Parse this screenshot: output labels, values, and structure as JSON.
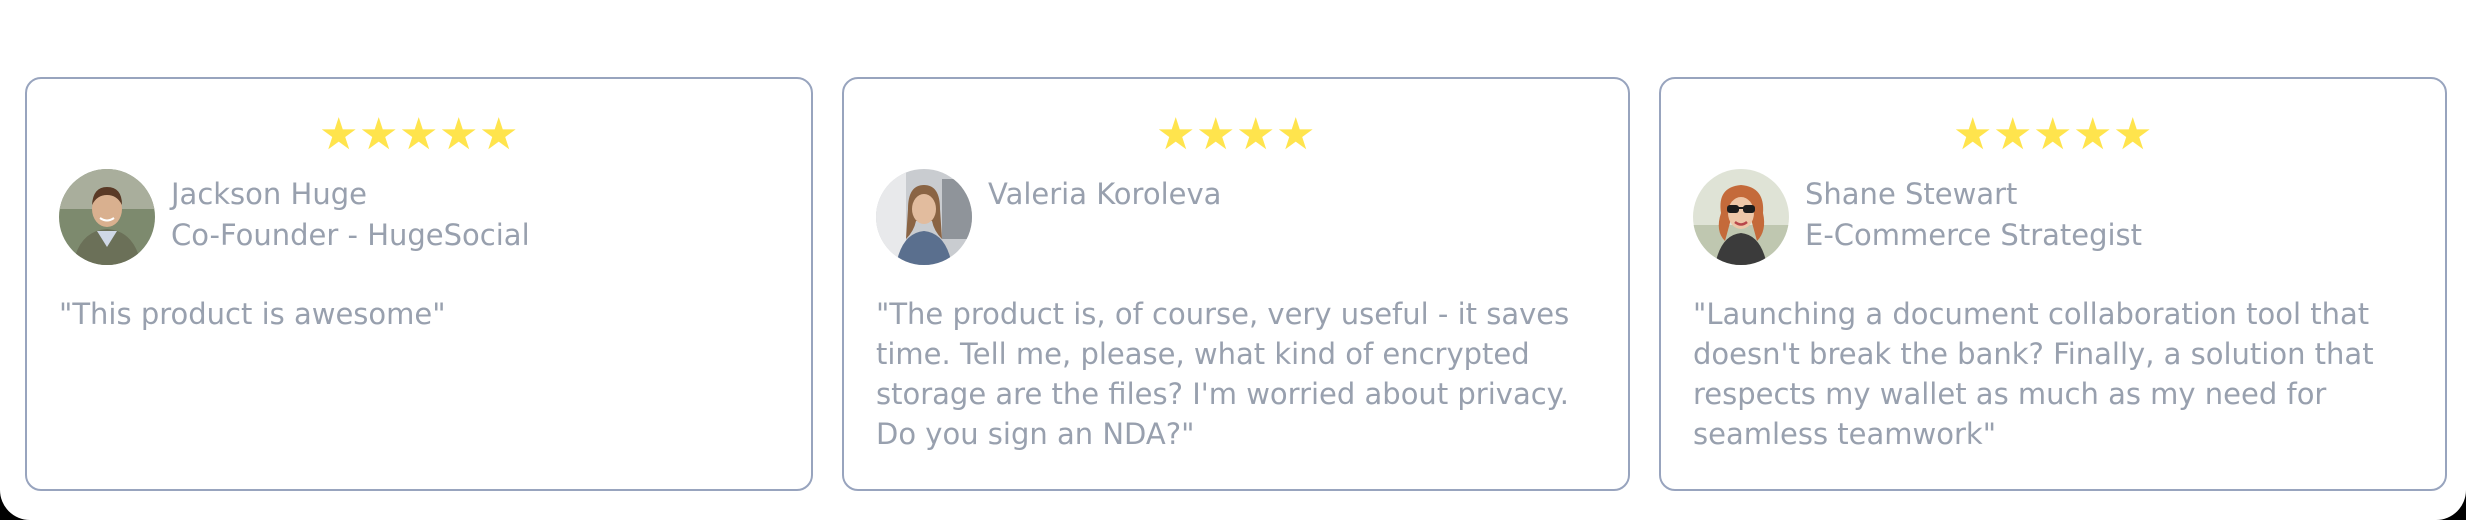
{
  "colors": {
    "card_border": "#98a4be",
    "text": "#98a0ae",
    "star": "#ffe44d",
    "background": "#ffffff"
  },
  "testimonials": [
    {
      "rating": 5,
      "avatar_icon": "avatar-photo",
      "name": "Jackson Huge",
      "title": "Co-Founder - HugeSocial",
      "quote": "\"This product is awesome\""
    },
    {
      "rating": 4,
      "avatar_icon": "avatar-photo",
      "name": "Valeria Koroleva",
      "title": "",
      "quote": "\"The product is, of course, very useful - it saves time. Tell me, please, what kind of encrypted storage are the files? I'm worried about privacy. Do you sign an NDA?\""
    },
    {
      "rating": 5,
      "avatar_icon": "avatar-photo",
      "name": "Shane Stewart",
      "title": "E-Commerce Strategist",
      "quote": "\"Launching a document collaboration tool that doesn't break the bank? Finally, a solution that respects my wallet as much as my need for seamless teamwork\""
    }
  ]
}
